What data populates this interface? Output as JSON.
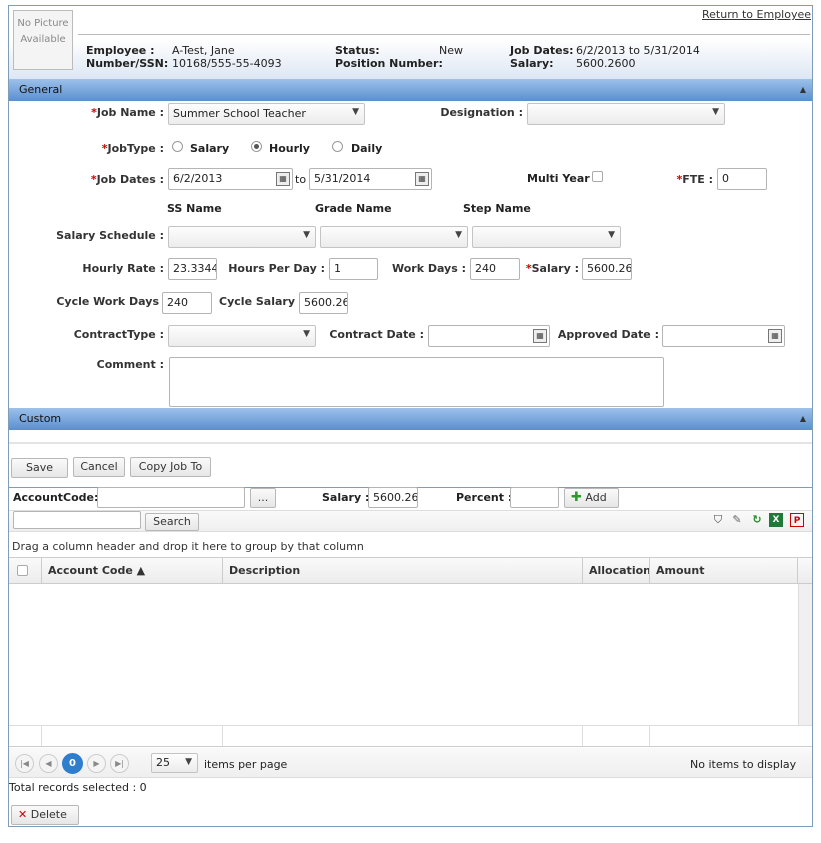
{
  "header": {
    "no_picture": "No Picture Available",
    "return_link": "Return to Employee",
    "employee_label": "Employee :",
    "employee_value": "A-Test, Jane",
    "number_label": "Number/SSN:",
    "number_value": "10168/555-55-4093",
    "status_label": "Status:",
    "status_value": "New",
    "position_label": "Position Number:",
    "jobdates_label": "Job Dates:",
    "jobdates_value": "6/2/2013 to 5/31/2014",
    "salary_label": "Salary:",
    "salary_value": "5600.2600"
  },
  "general": {
    "title": "General",
    "job_name_label": "Job Name :",
    "job_name_value": "Summer School Teacher",
    "designation_label": "Designation :",
    "jobtype_label": "JobType :",
    "jobtype_options": [
      "Salary",
      "Hourly",
      "Daily"
    ],
    "jobtype_selected": "Hourly",
    "job_dates_label": "Job Dates :",
    "start_date": "6/2/2013",
    "to_label": "to",
    "end_date": "5/31/2014",
    "multi_year_label": "Multi Year",
    "fte_label": "FTE :",
    "fte_value": "0",
    "ss_name_label": "SS Name",
    "grade_name_label": "Grade Name",
    "step_name_label": "Step Name",
    "salary_schedule_label": "Salary Schedule :",
    "hourly_rate_label": "Hourly Rate :",
    "hourly_rate_value": "23.3344",
    "hours_per_day_label": "Hours Per Day :",
    "hours_per_day_value": "1",
    "work_days_label": "Work Days :",
    "work_days_value": "240",
    "salary_label": "Salary :",
    "salary_value": "5600.26",
    "cycle_work_days_label": "Cycle Work Days",
    "cycle_work_days_value": "240",
    "cycle_salary_label": "Cycle Salary",
    "cycle_salary_value": "5600.26",
    "contract_type_label": "ContractType :",
    "contract_date_label": "Contract Date :",
    "approved_date_label": "Approved Date :",
    "comment_label": "Comment :",
    "required_mark": "*"
  },
  "custom": {
    "title": "Custom"
  },
  "actions": {
    "save": "Save",
    "cancel": "Cancel",
    "copy_job": "Copy Job To"
  },
  "account": {
    "account_code_label": "AccountCode:",
    "browse": "...",
    "salary_label": "Salary :",
    "salary_value": "5600.26",
    "percent_label": "Percent :",
    "add": "Add",
    "search_button": "Search"
  },
  "grid": {
    "group_hint": "Drag a column header and drop it here to group by that column",
    "columns": [
      "Account Code ▲",
      "Description",
      "Allocation(",
      "Amount"
    ],
    "page_number": "0",
    "page_size": "25",
    "items_per_page": "items per page",
    "no_items": "No items to display"
  },
  "footer": {
    "total_selected": "Total records selected : 0",
    "delete": "Delete"
  }
}
